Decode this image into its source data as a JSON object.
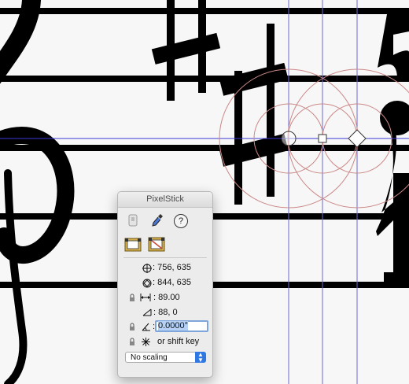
{
  "panel": {
    "title": "PixelStick",
    "point1": ": 756, 635",
    "point2": ": 844, 635",
    "distance": ": 89.00",
    "delta": ": 88, 0",
    "angle_prefix": ":",
    "angle_value": "0.0000°",
    "shift_text": "or shift key",
    "scaling": "No scaling"
  }
}
